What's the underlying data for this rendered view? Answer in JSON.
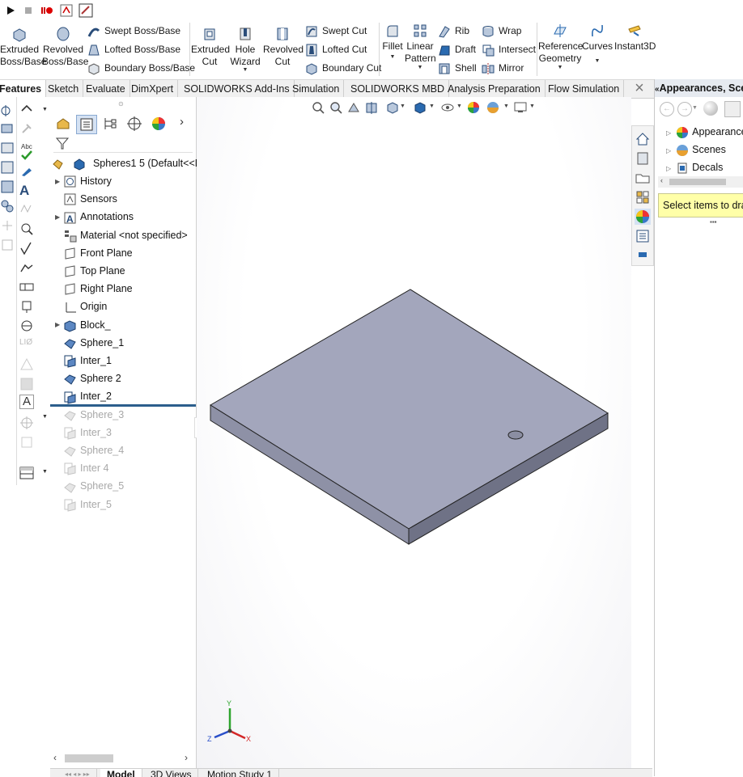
{
  "quick_toolbar": [
    "run-icon",
    "stop-icon",
    "record-icon",
    "macro-icon",
    "edit-macro-icon"
  ],
  "ribbon": {
    "extruded_boss": "Extruded\nBoss/Base",
    "revolved_boss": "Revolved\nBoss/Base",
    "swept_boss": "Swept Boss/Base",
    "lofted_boss": "Lofted Boss/Base",
    "boundary_boss": "Boundary Boss/Base",
    "extruded_cut": "Extruded\nCut",
    "hole_wizard": "Hole\nWizard",
    "revolved_cut": "Revolved\nCut",
    "swept_cut": "Swept Cut",
    "lofted_cut": "Lofted Cut",
    "boundary_cut": "Boundary Cut",
    "fillet": "Fillet",
    "linear_pattern": "Linear\nPattern",
    "rib": "Rib",
    "draft": "Draft",
    "shell": "Shell",
    "wrap": "Wrap",
    "intersect": "Intersect",
    "mirror": "Mirror",
    "reference_geometry": "Reference\nGeometry",
    "curves": "Curves",
    "instant3d": "Instant3D"
  },
  "tabs": [
    "Features",
    "Sketch",
    "Evaluate",
    "DimXpert",
    "SOLIDWORKS Add-Ins",
    "Simulation",
    "SOLIDWORKS MBD",
    "Analysis Preparation",
    "Flow Simulation"
  ],
  "right_panel": {
    "title": "Appearances, Sce",
    "items": [
      "Appearance",
      "Scenes",
      "Decals"
    ],
    "message": "Select items to dra"
  },
  "tree": {
    "root": "Spheres1 5  (Default<<D",
    "items": [
      {
        "label": "History",
        "arrow": true,
        "dim": false
      },
      {
        "label": "Sensors",
        "arrow": false,
        "dim": false
      },
      {
        "label": "Annotations",
        "arrow": true,
        "dim": false
      },
      {
        "label": "Material <not specified>",
        "arrow": false,
        "dim": false
      },
      {
        "label": "Front Plane",
        "arrow": false,
        "dim": false
      },
      {
        "label": "Top Plane",
        "arrow": false,
        "dim": false
      },
      {
        "label": "Right Plane",
        "arrow": false,
        "dim": false
      },
      {
        "label": "Origin",
        "arrow": false,
        "dim": false
      },
      {
        "label": "Block_",
        "arrow": true,
        "dim": false
      },
      {
        "label": "Sphere_1",
        "arrow": false,
        "dim": false
      },
      {
        "label": "Inter_1",
        "arrow": false,
        "dim": false
      },
      {
        "label": "Sphere 2",
        "arrow": false,
        "dim": false
      },
      {
        "label": "Inter_2",
        "arrow": false,
        "dim": false
      },
      {
        "label": "Sphere_3",
        "arrow": false,
        "dim": true
      },
      {
        "label": "Inter_3",
        "arrow": false,
        "dim": true
      },
      {
        "label": "Sphere_4",
        "arrow": false,
        "dim": true
      },
      {
        "label": "Inter 4",
        "arrow": false,
        "dim": true
      },
      {
        "label": "Sphere_5",
        "arrow": false,
        "dim": true
      },
      {
        "label": "Inter_5",
        "arrow": false,
        "dim": true
      }
    ]
  },
  "bottom_tabs": [
    "Model",
    "3D Views",
    "Motion Study 1"
  ],
  "triad": {
    "x": "X",
    "y": "Y",
    "z": "Z"
  },
  "colors": {
    "accent": "#2c5e8c",
    "part_top": "#a3a6bc",
    "part_side": "#6f7286"
  }
}
